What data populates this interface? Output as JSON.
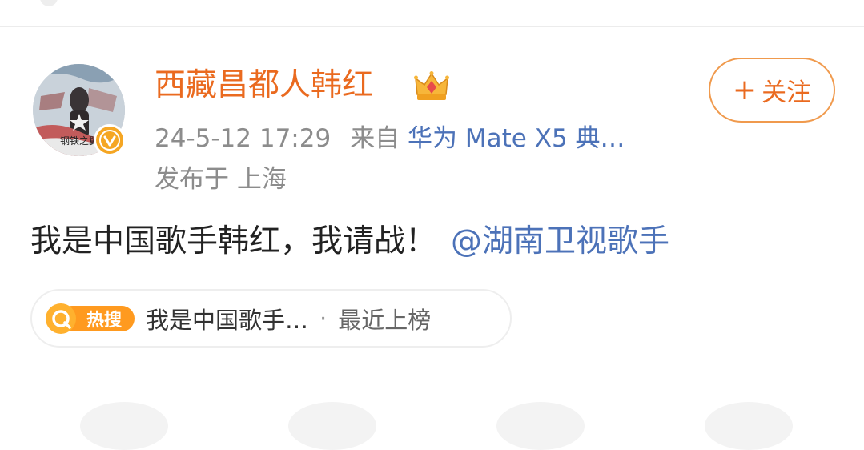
{
  "post": {
    "author": "西藏昌都人韩红",
    "time": "24-5-12 17:29",
    "from_label": "来自",
    "source": "华为 Mate X5 典…",
    "location": "发布于 上海",
    "body": "我是中国歌手韩红，我请战！",
    "mention": "@湖南卫视歌手",
    "avatar_badge_text": "钢铁之翼"
  },
  "follow_button": {
    "plus": "+",
    "label": "关注"
  },
  "hot_search": {
    "badge_label": "热搜",
    "topic": "我是中国歌手…",
    "separator": "·",
    "status": "最近上榜"
  },
  "colors": {
    "accent_orange": "#ea6a1f",
    "link_blue": "#4c72b8",
    "meta_gray": "#8c8c8c",
    "verified_badge": "#f5a623"
  },
  "icons": [
    "verified-v-icon",
    "crown-icon",
    "hot-search-q-icon"
  ]
}
